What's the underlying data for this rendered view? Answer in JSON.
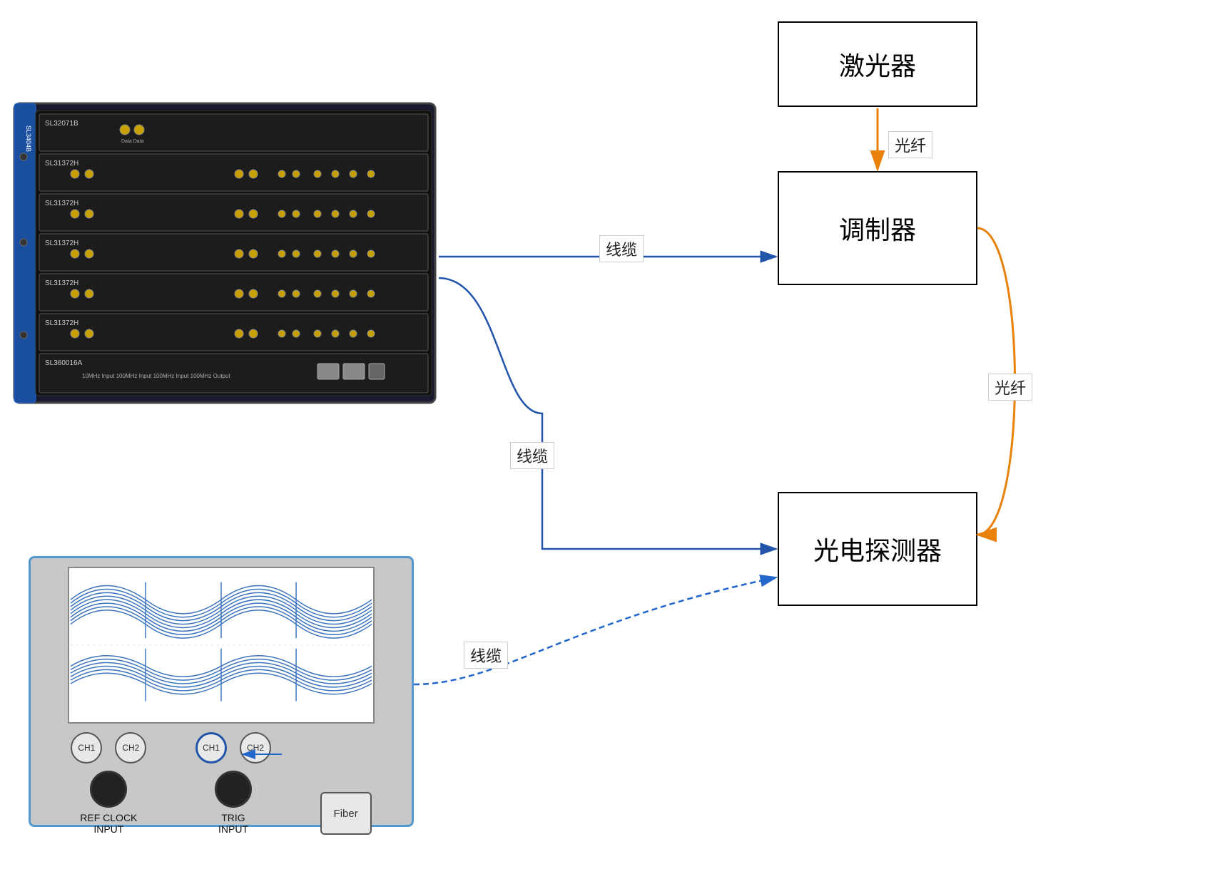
{
  "boxes": {
    "laser": {
      "label": "激光器"
    },
    "modulator": {
      "label": "调制器"
    },
    "detector": {
      "label": "光电探测器"
    }
  },
  "labels": {
    "fiber1": "光纤",
    "fiber2": "光纤",
    "cable1": "线缆",
    "cable2": "线缆",
    "cable3": "线缆"
  },
  "scope": {
    "ch1_out_label": "CH1",
    "ch2_out_label": "CH2",
    "ch1_in_label": "CH1",
    "ch2_in_label": "CH2",
    "fiber_label": "Fiber",
    "ref_clock": "REF CLOCK\nINPUT",
    "trig_input": "TRIG\nINPUT"
  },
  "rack": {
    "model": "SL3404B",
    "modules": [
      "SL32071B",
      "SL31372H",
      "SL31372H",
      "SL31372H",
      "SL31372H",
      "SL31372H",
      "SL360016A"
    ]
  },
  "colors": {
    "orange_arrow": "#e8820a",
    "blue_line": "#2255aa",
    "blue_dashed": "#2266cc",
    "box_border": "#000000",
    "scope_border": "#5599cc",
    "scope_bg": "#c8c8c8"
  }
}
